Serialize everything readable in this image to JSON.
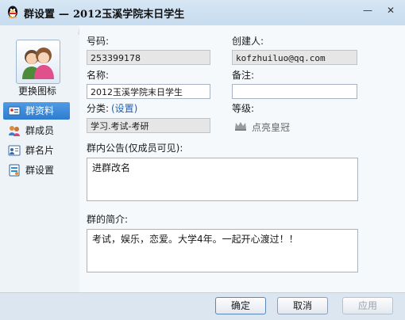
{
  "window": {
    "title_prefix": "群设置",
    "title_sep": "—",
    "title_group": "2012玉溪学院末日学生",
    "minimize_glyph": "—",
    "close_glyph": "✕"
  },
  "sidebar": {
    "change_icon_label": "更换图标",
    "items": [
      {
        "label": "群资料",
        "icon": "id-card-icon",
        "active": true
      },
      {
        "label": "群成员",
        "icon": "members-icon",
        "active": false
      },
      {
        "label": "群名片",
        "icon": "business-card-icon",
        "active": false
      },
      {
        "label": "群设置",
        "icon": "settings-icon",
        "active": false
      }
    ]
  },
  "form": {
    "number_label": "号码:",
    "number_value": "253399178",
    "creator_label": "创建人:",
    "creator_value": "kofzhuiluo@qq.com",
    "name_label": "名称:",
    "name_value": "2012玉溪学院末日学生",
    "note_label": "备注:",
    "note_value": "",
    "category_label": "分类:",
    "category_link": "(设置)",
    "category_value": "学习.考试-考研",
    "level_label": "等级:",
    "crown_link": "点亮皇冠",
    "notice_label": "群内公告(仅成员可见):",
    "notice_value": "进群改名",
    "intro_label": "群的简介:",
    "intro_value": "考试，娱乐，恋爱。大学4年。一起开心渡过！！"
  },
  "buttons": {
    "ok": "确定",
    "cancel": "取消",
    "apply": "应用"
  },
  "colors": {
    "accent": "#2f7cd0",
    "link": "#1c5fb8"
  }
}
